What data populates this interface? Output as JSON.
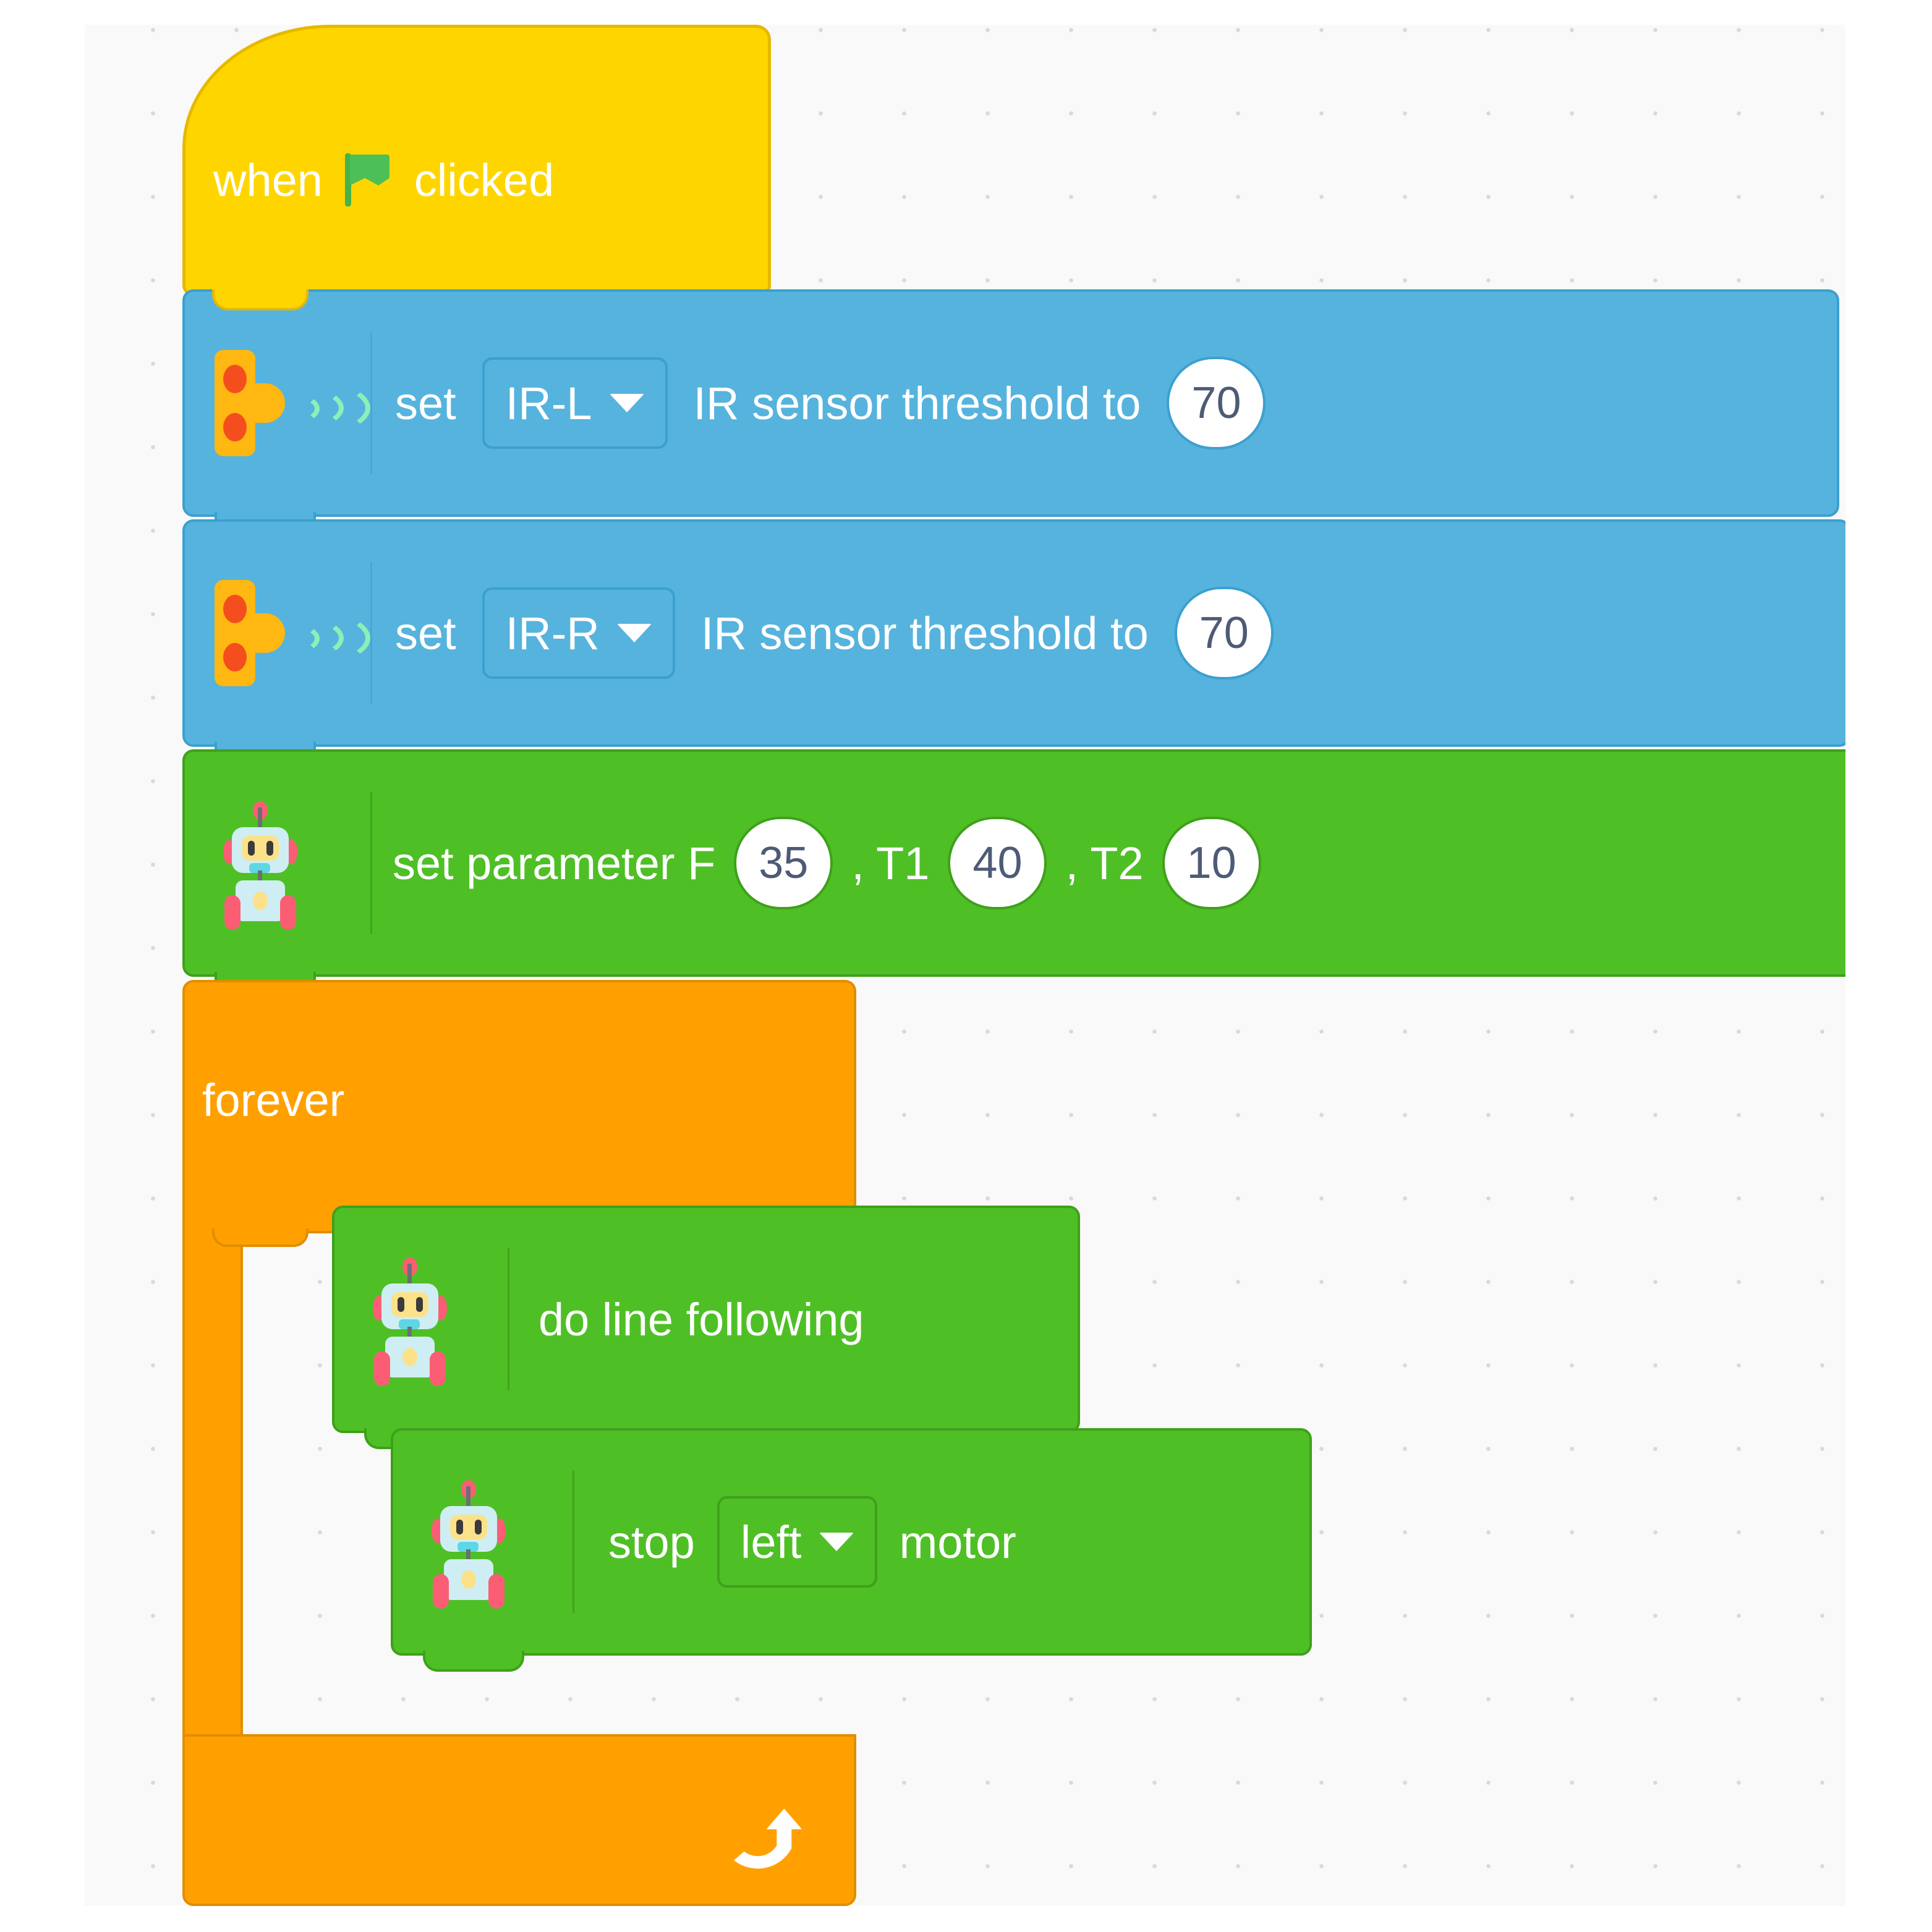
{
  "workspace": {
    "background_color": "#f9f9f9",
    "dot_color": "#d9d9d9"
  },
  "script": {
    "hat": {
      "prefix_label": "when",
      "suffix_label": "clicked",
      "icon": "green-flag-icon",
      "color": "#ffd500"
    },
    "blocks": [
      {
        "id": "ir-threshold-left",
        "icon": "ir-sensor-icon",
        "color": "#56b3dd",
        "prefix_label": "set",
        "dropdown_value": "IR-L",
        "mid_label": "IR sensor threshold to",
        "value": "70"
      },
      {
        "id": "ir-threshold-right",
        "icon": "ir-sensor-icon",
        "color": "#56b3dd",
        "prefix_label": "set",
        "dropdown_value": "IR-R",
        "mid_label": "IR sensor threshold to",
        "value": "70"
      },
      {
        "id": "set-parameter",
        "icon": "robot-icon",
        "color": "#4fbf26",
        "prefix_label": "set parameter F",
        "f_value": "35",
        "t1_label": ", T1",
        "t1_value": "40",
        "t2_label": ", T2",
        "t2_value": "10"
      }
    ],
    "loop": {
      "id": "forever-loop",
      "label": "forever",
      "color": "#ffa000",
      "loop_icon": "loop-arrow-icon",
      "children": [
        {
          "id": "do-line-following",
          "icon": "robot-icon",
          "color": "#4fbf26",
          "label": "do line following"
        },
        {
          "id": "stop-motor",
          "icon": "robot-icon",
          "color": "#4fbf26",
          "prefix_label": "stop",
          "dropdown_value": "left",
          "suffix_label": "motor"
        }
      ]
    }
  }
}
